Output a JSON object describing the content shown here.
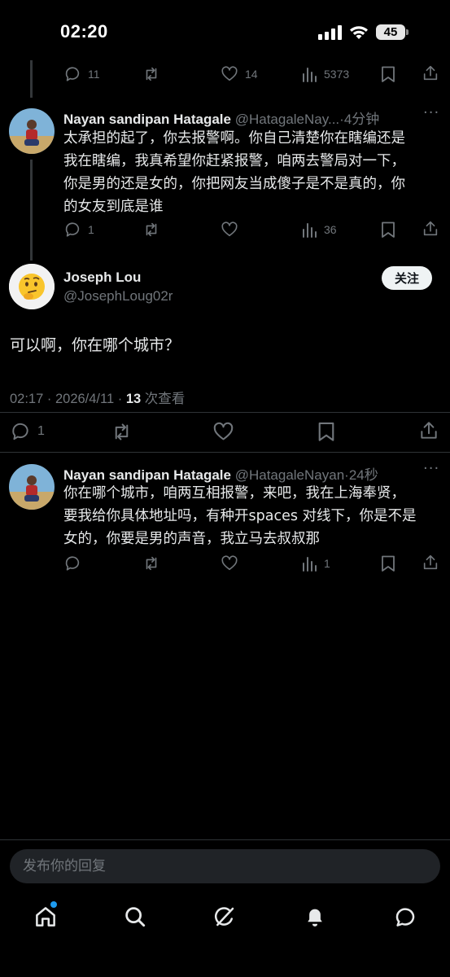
{
  "status_bar": {
    "time": "02:20",
    "battery": "45"
  },
  "thread": [
    {
      "actions": {
        "replies": "11",
        "retweets": "",
        "likes": "14",
        "views": "5373"
      }
    },
    {
      "author": {
        "name": "Nayan sandipan Hatagale",
        "handle": "@HatagaleNay...",
        "time": "4分钟"
      },
      "text_lines": [
        "太承担的起了，你去报警啊。你自己清楚你在瞎编还是",
        "我在瞎编，我真希望你赶紧报警，咱两去警局对一下，",
        "你是男的还是女的，你把网友当成傻子是不是真的，你",
        "的女友到底是谁"
      ],
      "actions": {
        "replies": "1",
        "retweets": "",
        "likes": "",
        "views": "36"
      }
    }
  ],
  "main_tweet": {
    "author": {
      "name": "Joseph Lou",
      "handle": "@JosephLoug02r"
    },
    "follow_label": "关注",
    "text": "可以啊，你在哪个城市？",
    "meta": {
      "time": "02:17",
      "date": "2026/4/11",
      "views_count": "13",
      "views_label": "次查看"
    },
    "actions": {
      "replies": "1"
    }
  },
  "reply": {
    "author": {
      "name": "Nayan sandipan Hatagale",
      "handle": "@HatagaleNayan",
      "time": "24秒"
    },
    "text_lines": [
      "你在哪个城市，咱两互相报警，来吧，我在上海奉贤，",
      "要我给你具体地址吗，有种开spaces 对线下，你是不是",
      "女的，你要是男的声音，我立马去叔叔那"
    ],
    "actions": {
      "replies": "",
      "retweets": "",
      "likes": "",
      "views": "1"
    }
  },
  "reply_bar": {
    "placeholder": "发布你的回复"
  },
  "bottom_nav": {
    "items": [
      "home-icon",
      "search-icon",
      "grok-icon",
      "notifications-icon",
      "messages-icon"
    ],
    "accent": "#1d9bf0"
  }
}
